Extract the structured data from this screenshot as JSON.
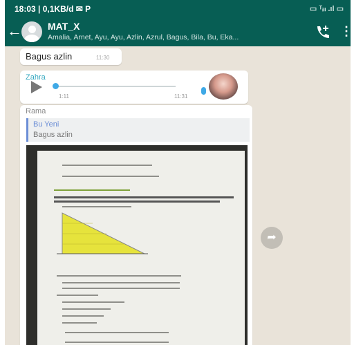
{
  "status_bar": {
    "time": "18:03 | 0,1KB/d ✉ P",
    "icons": "▭ ᵀᵢₗₗ .ıl ▭"
  },
  "header": {
    "back_icon": "arrow-left-icon",
    "title": "MAT_X",
    "members": "Amalia, Arnet, Ayu, Ayu, Azlin, Azrul, Bagus, Bila, Bu, Eka...",
    "menu_glyph": "⋮"
  },
  "messages": [
    {
      "text": "Bagus azlin",
      "time": "11:30"
    },
    {
      "sender": "Zahra",
      "type": "voice",
      "duration": "1:11",
      "time": "11:31"
    },
    {
      "sender": "Rama",
      "quote": {
        "name": "Bu Yeni",
        "text": "Bagus azlin"
      },
      "type": "image"
    }
  ],
  "forward_icon": "forward-icon",
  "colors": {
    "header": "#075e54",
    "chat_bg": "#e9e3d9",
    "accent": "#3fa9e6"
  }
}
